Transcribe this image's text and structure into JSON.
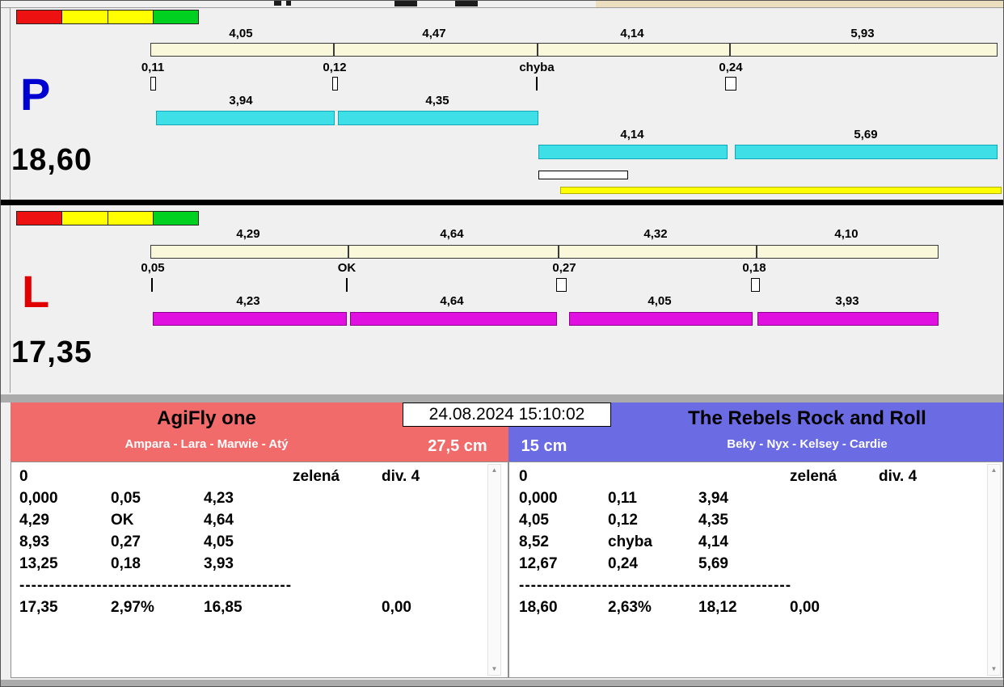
{
  "timestamp": "24.08.2024 15:10:02",
  "icons": {
    "scroll_up": "▲",
    "scroll_down": "▼"
  },
  "panel_p": {
    "letter": "P",
    "total": "18,60",
    "segment_labels": [
      "4,05",
      "4,47",
      "4,14",
      "5,93"
    ],
    "gate_labels": [
      "0,11",
      "0,12",
      "chyba",
      "0,24"
    ],
    "run_bars_row1": [
      "3,94",
      "4,35"
    ],
    "run_bars_row2": [
      "4,14",
      "5,69"
    ]
  },
  "panel_l": {
    "letter": "L",
    "total": "17,35",
    "segment_labels": [
      "4,29",
      "4,64",
      "4,32",
      "4,10"
    ],
    "gate_labels": [
      "0,05",
      "OK",
      "0,27",
      "0,18"
    ],
    "run_bars": [
      "4,23",
      "4,64",
      "4,05",
      "3,93"
    ]
  },
  "team_left": {
    "name": "AgiFly one",
    "members": "Ampara - Lara - Marwie - Atý",
    "category": "27,5 cm",
    "info_row": {
      "col1": "0",
      "col4": "zelená",
      "col5": "div. 4"
    },
    "rows": [
      [
        "0,000",
        "0,05",
        "4,23"
      ],
      [
        "4,29",
        "OK",
        "4,64"
      ],
      [
        "8,93",
        "0,27",
        "4,05"
      ],
      [
        "13,25",
        "0,18",
        "3,93"
      ]
    ],
    "separator": "----------------------------------------------",
    "totals": [
      "17,35",
      "2,97%",
      "16,85",
      "0,00"
    ]
  },
  "team_right": {
    "name": "The Rebels Rock and Roll",
    "members": "Beky - Nyx - Kelsey - Cardie",
    "category": "15 cm",
    "info_row": {
      "col1": "0",
      "col4": "zelená",
      "col5": "div. 4"
    },
    "rows": [
      [
        "0,000",
        "0,11",
        "3,94"
      ],
      [
        "4,05",
        "0,12",
        "4,35"
      ],
      [
        "8,52",
        "chyba",
        "4,14"
      ],
      [
        "12,67",
        "0,24",
        "5,69"
      ]
    ],
    "separator": "----------------------------------------------",
    "totals": [
      "18,60",
      "2,63%",
      "18,12",
      "0,00"
    ]
  },
  "colors": {
    "cyan_bar": "#3fdfe8",
    "magenta_bar": "#e010e0",
    "cream_bar": "#faf8da",
    "team_left_header": "#f26b6b",
    "team_right_header": "#6b6be3",
    "letter_p": "#0000d0",
    "letter_l": "#e00000",
    "strip_red": "#ee1111",
    "strip_yellow": "#ffff00",
    "strip_green": "#00d020",
    "highlight_yellow": "#ffff00"
  }
}
